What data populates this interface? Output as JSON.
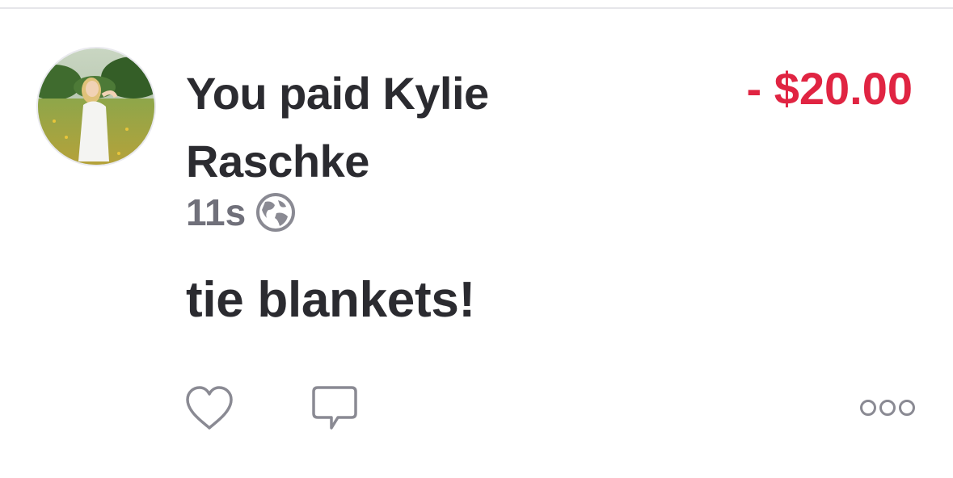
{
  "transaction": {
    "title": "You paid Kylie Raschke",
    "amount": "- $20.00",
    "amount_color": "#e02442",
    "time_ago": "11s",
    "privacy_icon": "globe-icon",
    "note": "tie blankets!"
  },
  "actions": {
    "like_icon": "heart-outline-icon",
    "comment_icon": "speech-bubble-icon",
    "more_icon": "three-dots-icon"
  }
}
